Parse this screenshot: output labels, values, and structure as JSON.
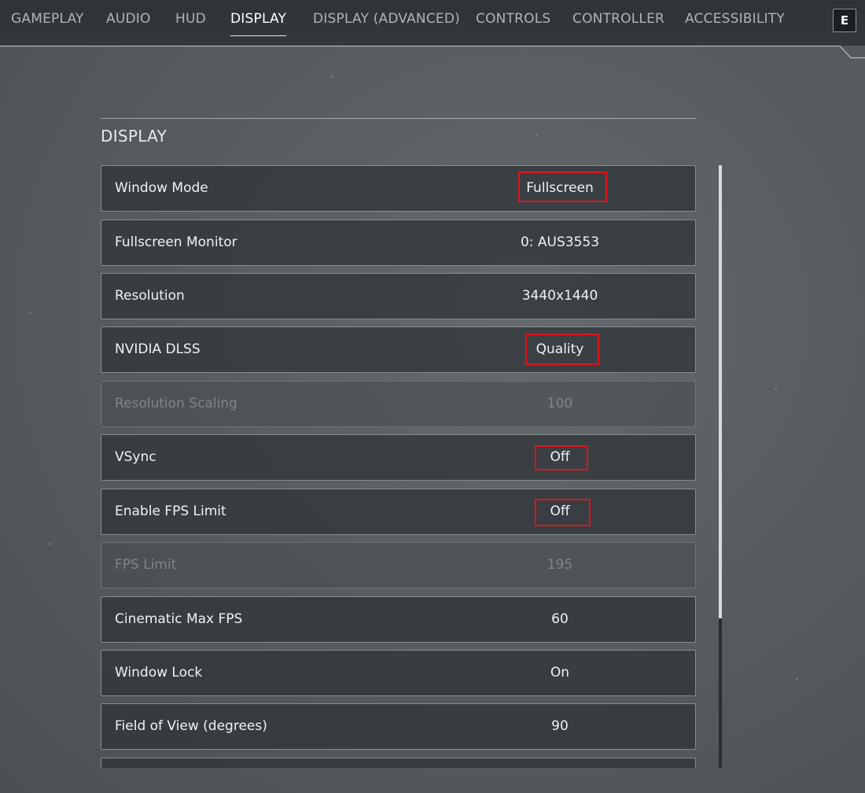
{
  "tabs": [
    {
      "label": "GAMEPLAY",
      "active": false
    },
    {
      "label": "AUDIO",
      "active": false
    },
    {
      "label": "HUD",
      "active": false
    },
    {
      "label": "DISPLAY",
      "active": true
    },
    {
      "label": "DISPLAY (ADVANCED)",
      "active": false
    },
    {
      "label": "CONTROLS",
      "active": false
    },
    {
      "label": "CONTROLLER",
      "active": false
    },
    {
      "label": "ACCESSIBILITY",
      "active": false
    }
  ],
  "key_hint": "E",
  "section": {
    "title": "DISPLAY"
  },
  "settings": [
    {
      "label": "Window Mode",
      "value": "Fullscreen",
      "disabled": false,
      "highlighted": true
    },
    {
      "label": "Fullscreen Monitor",
      "value": "0: AUS3553",
      "disabled": false,
      "highlighted": false
    },
    {
      "label": "Resolution",
      "value": "3440x1440",
      "disabled": false,
      "highlighted": false
    },
    {
      "label": "NVIDIA DLSS",
      "value": "Quality",
      "disabled": false,
      "highlighted": true
    },
    {
      "label": "Resolution Scaling",
      "value": "100",
      "disabled": true,
      "highlighted": false
    },
    {
      "label": "VSync",
      "value": "Off",
      "disabled": false,
      "highlighted": true
    },
    {
      "label": "Enable FPS Limit",
      "value": "Off",
      "disabled": false,
      "highlighted": true
    },
    {
      "label": "FPS Limit",
      "value": "195",
      "disabled": true,
      "highlighted": false
    },
    {
      "label": "Cinematic Max FPS",
      "value": "60",
      "disabled": false,
      "highlighted": false
    },
    {
      "label": "Window Lock",
      "value": "On",
      "disabled": false,
      "highlighted": false
    },
    {
      "label": "Field of View (degrees)",
      "value": "90",
      "disabled": false,
      "highlighted": false
    }
  ],
  "colors": {
    "highlight_border": "#e0141c",
    "row_background": "#303438",
    "active_tab": "#ffffff",
    "inactive_tab": "#aeb4b8"
  }
}
